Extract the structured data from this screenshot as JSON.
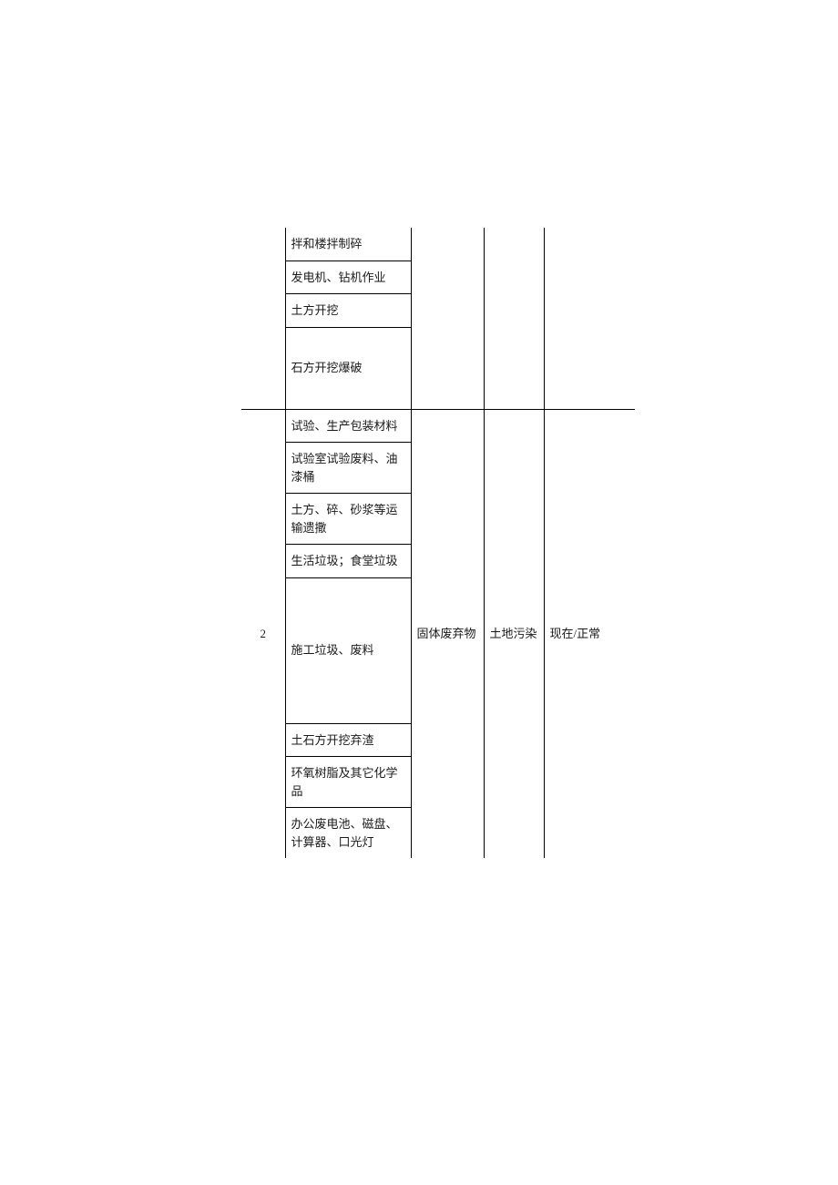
{
  "section1": {
    "rows": [
      "拌和楼拌制碎",
      "发电机、钻机作业",
      "土方开挖",
      "石方开挖爆破"
    ]
  },
  "section2": {
    "row_num": "2",
    "activities": [
      "试验、生产包装材料",
      "试验室试验废料、油漆桶",
      "土方、碎、砂浆等运输遗撒",
      "生活垃圾；食堂垃圾",
      "施工垃圾、废料",
      "土石方开挖弃渣",
      "环氧树脂及其它化学品",
      "办公废电池、磁盘、计算器、口光灯"
    ],
    "factor": "固体废弃物",
    "impact": "土地污染",
    "time_state": "现在/正常"
  }
}
